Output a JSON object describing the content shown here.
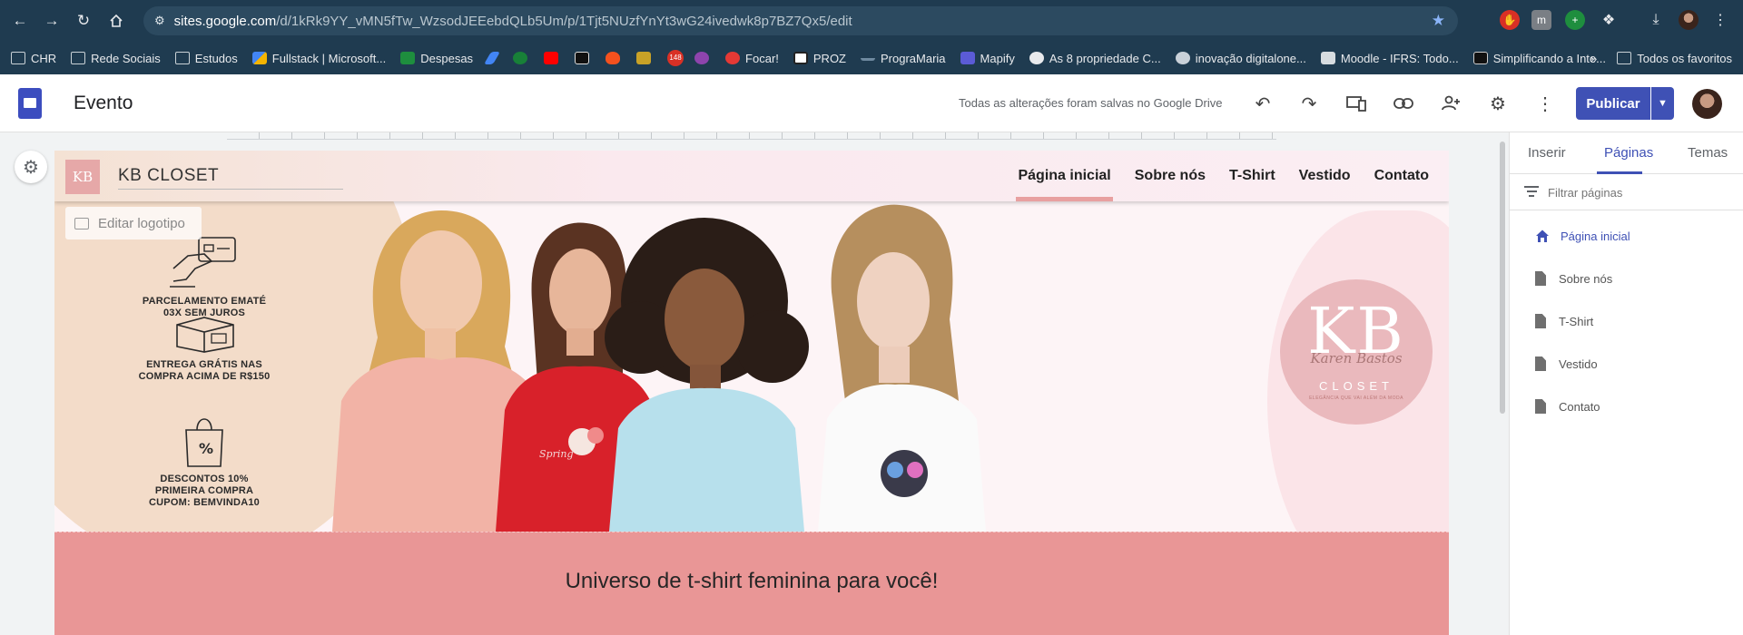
{
  "browser": {
    "url_host": "sites.google.com",
    "url_path": "/d/1kRk9YY_vMN5fTw_WzsodJEEebdQLb5Um/p/1Tjt5NUzfYnYt3wG24ivedwk8p7BZ7Qx5/edit",
    "bookmarks": [
      {
        "label": "CHR",
        "icon": "folder-icon"
      },
      {
        "label": "Rede Sociais",
        "icon": "folder-icon"
      },
      {
        "label": "Estudos",
        "icon": "folder-icon"
      },
      {
        "label": "Fullstack | Microsoft...",
        "icon": "microsoft-icon"
      },
      {
        "label": "Despesas",
        "icon": "sheets-icon"
      },
      {
        "label": "",
        "icon": "pen-icon"
      },
      {
        "label": "",
        "icon": "whatsapp-icon"
      },
      {
        "label": "",
        "icon": "youtube-icon"
      },
      {
        "label": "",
        "icon": "amazon-icon"
      },
      {
        "label": "",
        "icon": "fire-icon"
      },
      {
        "label": "",
        "icon": "badge-icon"
      },
      {
        "label": "",
        "icon": "count-icon"
      },
      {
        "label": "",
        "icon": "shield-icon"
      },
      {
        "label": "Focar!",
        "icon": "check-icon"
      },
      {
        "label": "PROZ",
        "icon": "notion-icon"
      },
      {
        "label": "PrograMaria",
        "icon": "dots-icon"
      },
      {
        "label": "Mapify",
        "icon": "bolt-icon"
      },
      {
        "label": "As 8 propriedade C...",
        "icon": "globe-icon"
      },
      {
        "label": "inovação digitalone...",
        "icon": "github-icon"
      },
      {
        "label": "Moodle - IFRS: Todo...",
        "icon": "moodle-icon"
      },
      {
        "label": "Simplificando a Inte...",
        "icon": "medium-icon"
      }
    ],
    "all_bookmarks": "Todos os favoritos",
    "bookmark_count_badge": "148"
  },
  "editor": {
    "doc_title": "Evento",
    "saved_message": "Todas as alterações foram salvas no Google Drive",
    "publish_label": "Publicar"
  },
  "site": {
    "logo_text": "KB",
    "title": "KB CLOSET",
    "edit_logo": "Editar logotipo",
    "nav": [
      {
        "label": "Página inicial",
        "active": true
      },
      {
        "label": "Sobre nós",
        "active": false
      },
      {
        "label": "T-Shirt",
        "active": false
      },
      {
        "label": "Vestido",
        "active": false
      },
      {
        "label": "Contato",
        "active": false
      }
    ],
    "perks": [
      {
        "line1": "PARCELAMENTO EMATÉ",
        "line2": "03X SEM JUROS",
        "line3": ""
      },
      {
        "line1": "ENTREGA GRÁTIS NAS",
        "line2": "COMPRA ACIMA DE R$150",
        "line3": ""
      },
      {
        "line1": "DESCONTOS 10%",
        "line2": "PRIMEIRA COMPRA",
        "line3": "CUPOM: BEMVINDA10"
      }
    ],
    "brand_mark": {
      "letters": "KB",
      "signature": "Karen Bastos",
      "word": "CLOSET",
      "tagline": "ELEGÂNCIA QUE VAI ALÉM DA MODA"
    },
    "banner_text": "Universo de t-shirt feminina para você!",
    "shirt_print": "Spring"
  },
  "panel": {
    "tabs": [
      {
        "label": "Inserir",
        "active": false
      },
      {
        "label": "Páginas",
        "active": true
      },
      {
        "label": "Temas",
        "active": false
      }
    ],
    "filter_placeholder": "Filtrar páginas",
    "pages": [
      {
        "label": "Página inicial",
        "icon": "home-icon",
        "active": true
      },
      {
        "label": "Sobre nós",
        "icon": "page-icon",
        "active": false
      },
      {
        "label": "T-Shirt",
        "icon": "page-icon",
        "active": false
      },
      {
        "label": "Vestido",
        "icon": "page-icon",
        "active": false
      },
      {
        "label": "Contato",
        "icon": "page-icon",
        "active": false
      }
    ]
  },
  "colors": {
    "browser_bg": "#1f3b50",
    "accent": "#3f51b5",
    "banner": "#e99696",
    "nav_underline": "#e8a0a0"
  }
}
